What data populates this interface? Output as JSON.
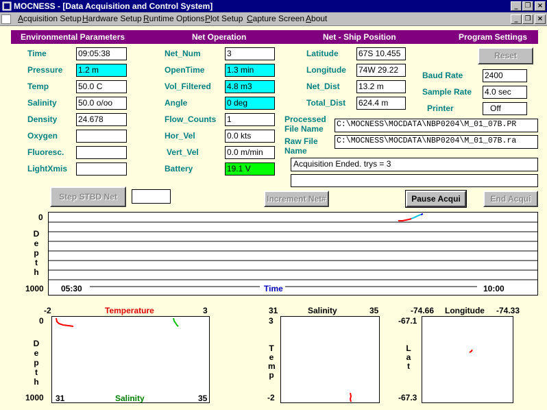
{
  "window": {
    "title": "MOCNESS - [Data Acquisition and Control System]",
    "minimize": "_",
    "restore": "❐",
    "close": "×"
  },
  "menu": [
    {
      "label": "Acquisition Setup",
      "key": "A"
    },
    {
      "label": "Hardware Setup",
      "key": "H"
    },
    {
      "label": "Runtime Options",
      "key": "R"
    },
    {
      "label": "Plot Setup",
      "key": "P"
    },
    {
      "label": "Capture Screen",
      "key": "C"
    },
    {
      "label": "About",
      "key": "A"
    }
  ],
  "headers": {
    "environmental": "Environmental Parameters",
    "net_operation": "Net Operation",
    "position": "Net - Ship Position",
    "settings": "Program Settings"
  },
  "environmental": {
    "time": {
      "label": "Time",
      "value": "09:05:38"
    },
    "pressure": {
      "label": "Pressure",
      "value": "1.2 m"
    },
    "temp": {
      "label": "Temp",
      "value": "50.0 C"
    },
    "salinity": {
      "label": "Salinity",
      "value": "50.0 o/oo"
    },
    "density": {
      "label": "Density",
      "value": "24.678"
    },
    "oxygen": {
      "label": "Oxygen",
      "value": ""
    },
    "fluoresc": {
      "label": "Fluoresc.",
      "value": ""
    },
    "lightxmis": {
      "label": "LightXmis",
      "value": ""
    }
  },
  "net": {
    "net_num": {
      "label": "Net_Num",
      "value": "3"
    },
    "opentime": {
      "label": "OpenTime",
      "value": "1.3 min"
    },
    "vol_filtered": {
      "label": "Vol_Filtered",
      "value": "4.8 m3"
    },
    "angle": {
      "label": "Angle",
      "value": "0 deg"
    },
    "flow_counts": {
      "label": "Flow_Counts",
      "value": "1"
    },
    "hor_vel": {
      "label": "Hor_Vel",
      "value": "0.0 kts"
    },
    "vert_vel": {
      "label": "Vert_Vel",
      "value": "0.0 m/min"
    },
    "battery": {
      "label": "Battery",
      "value": "19.1 V"
    }
  },
  "position": {
    "latitude": {
      "label": "Latitude",
      "value": "67S 10.455"
    },
    "longitude": {
      "label": "Longitude",
      "value": "74W 29.22"
    },
    "net_dist": {
      "label": "Net_Dist",
      "value": "13.2 m"
    },
    "total_dist": {
      "label": "Total_Dist",
      "value": "624.4 m"
    }
  },
  "settings": {
    "reset": "Reset",
    "baud_rate": {
      "label": "Baud Rate",
      "value": "2400"
    },
    "sample_rate": {
      "label": "Sample Rate",
      "value": "4.0 sec"
    },
    "printer": {
      "label": "Printer",
      "value": "Off"
    }
  },
  "files": {
    "processed_label_1": "Processed",
    "processed_label_2": "File Name",
    "processed_value": "C:\\MOCNESS\\MOCDATA\\NBP0204\\M_01_07B.PR",
    "raw_label_1": "Raw File",
    "raw_label_2": "Name",
    "raw_value": "C:\\MOCNESS\\MOCDATA\\NBP0204\\M_01_07B.ra"
  },
  "status": {
    "message": "Acquisition Ended. trys = 3",
    "message2": ""
  },
  "buttons": {
    "step": "Step STBD Net",
    "step_field": "",
    "increment": "Increment Net#",
    "pause": "Pause Acqui",
    "end": "End Acqui"
  },
  "time_plot": {
    "y_top": "0",
    "y_bottom": "1000",
    "y_label": [
      "D",
      "e",
      "p",
      "t",
      "h"
    ],
    "x_start": "05:30",
    "x_end": "10:00",
    "x_label": "Time"
  },
  "ts_plot": {
    "temp_min": "-2",
    "temp_max": "3",
    "temp_label": "Temperature",
    "sal_min": "31",
    "sal_max": "35",
    "sal_label": "Salinity",
    "depth_top": "0",
    "depth_bottom": "1000",
    "y_label": [
      "D",
      "e",
      "p",
      "t",
      "h"
    ]
  },
  "salt_plot": {
    "x_min": "31",
    "x_max": "35",
    "x_label": "Salinity",
    "y_top": "3",
    "y_bottom": "-2",
    "y_label": [
      "T",
      "e",
      "m",
      "p"
    ]
  },
  "pos_plot": {
    "x_min": "-74.66",
    "x_max": "-74.33",
    "x_label": "Longitude",
    "y_top": "-67.1",
    "y_bottom": "-67.3",
    "y_label": [
      "L",
      "a",
      "t"
    ]
  },
  "colors": {
    "title_bar": "#000080",
    "header": "#800080",
    "background": "#ffffe0",
    "label": "#008080",
    "cyan": "#00ffff",
    "green": "#00ff00",
    "temperature": "#ff0000",
    "salinity": "#008000",
    "time_label": "#0000c0"
  }
}
